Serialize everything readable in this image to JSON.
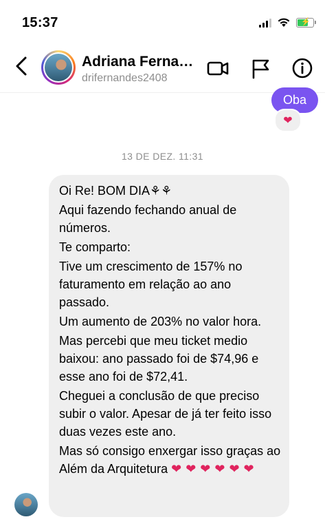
{
  "status_bar": {
    "time": "15:37",
    "icons": [
      "signal-icon",
      "wifi-icon",
      "battery-charging-icon"
    ]
  },
  "header": {
    "back_icon": "chevron-left-icon",
    "name": "Adriana Fernandes",
    "username": "drifernandes2408",
    "actions": [
      "video-call-icon",
      "flag-icon",
      "info-icon"
    ]
  },
  "conversation": {
    "outgoing": {
      "text": "Oba",
      "reaction": "❤️",
      "bubble_color": "#7a54f0"
    },
    "date_separator": "13 DE DEZ. 11:31",
    "incoming": {
      "lines": [
        "Oi Re! BOM DIA⚘⚘",
        "Aqui fazendo fechando anual de números.",
        "Te comparto:",
        "Tive um crescimento de 157% no faturamento em relação ao ano passado.",
        "Um aumento de 203% no valor hora.",
        "Mas percebi que meu ticket medio baixou: ano passado foi de $74,96 e esse ano foi de $72,41.",
        "Cheguei a conclusão de que preciso subir o valor. Apesar de já ter feito isso duas vezes este ano.",
        "Mas só consigo enxergar isso graças ao Além da Arquitetura"
      ],
      "hearts": "❤❤❤❤❤❤",
      "bubble_color": "#efefef"
    }
  },
  "colors": {
    "accent": "#7a54f0",
    "heart": "#e0245e",
    "muted": "#8e8e8e"
  }
}
